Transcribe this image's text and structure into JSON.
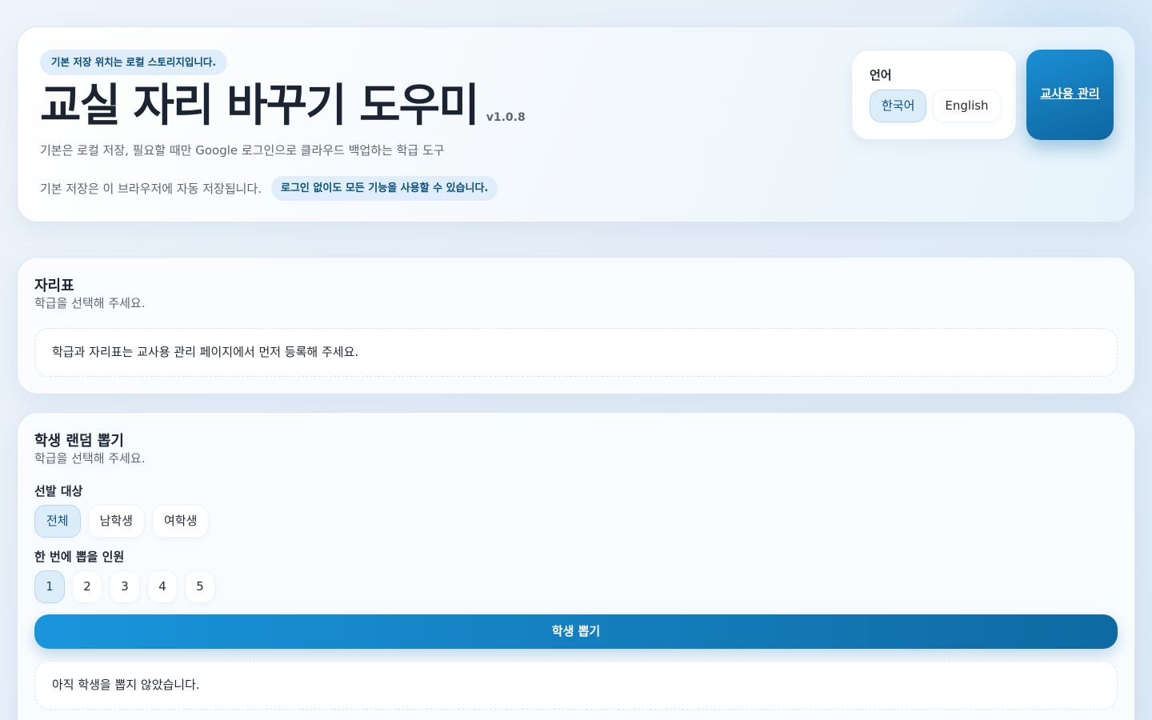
{
  "hero": {
    "storage_badge": "기본 저장 위치는 로컬 스토리지입니다.",
    "title": "교실 자리 바꾸기 도우미",
    "version": "v1.0.8",
    "subtitle": "기본은 로컬 저장, 필요할 때만 Google 로그인으로 클라우드 백업하는 학급 도구",
    "save_text": "기본 저장은 이 브라우저에 자동 저장됩니다.",
    "login_badge": "로그인 없이도 모든 기능을 사용할 수 있습니다."
  },
  "language": {
    "label": "언어",
    "options": [
      "한국어",
      "English"
    ],
    "selected": "한국어"
  },
  "admin_button": "교사용 관리",
  "seat_chart": {
    "title": "자리표",
    "subtitle": "학급을 선택해 주세요.",
    "notice": "학급과 자리표는 교사용 관리 페이지에서 먼저 등록해 주세요."
  },
  "random_draw": {
    "title": "학생 랜덤 뽑기",
    "subtitle": "학급을 선택해 주세요.",
    "target_label": "선발 대상",
    "target_options": [
      "전체",
      "남학생",
      "여학생"
    ],
    "target_selected": "전체",
    "count_label": "한 번에 뽑을 인원",
    "count_options": [
      "1",
      "2",
      "3",
      "4",
      "5"
    ],
    "count_selected": "1",
    "draw_button": "학생 뽑기",
    "result_text": "아직 학생을 뽑지 않았습니다."
  },
  "colors": {
    "accent": "#1a8fd3",
    "accent_dark": "#0e66a0",
    "chip_active_bg": "#dcedfa",
    "badge_text": "#0b4f7c"
  }
}
